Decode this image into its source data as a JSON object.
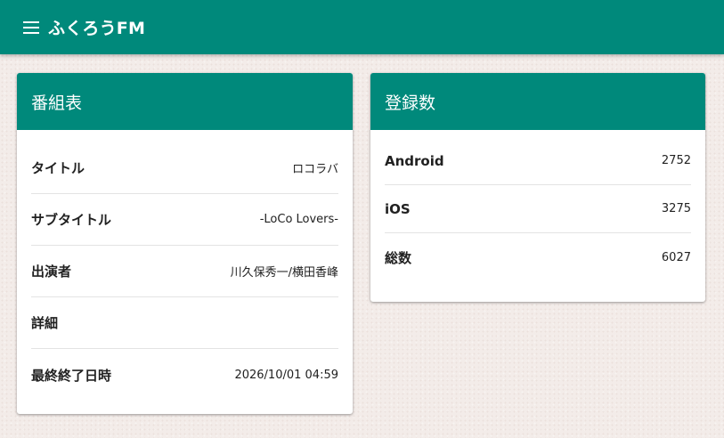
{
  "appbar": {
    "title": "ふくろうFM",
    "menu_icon": "hamburger-menu-icon"
  },
  "program_card": {
    "title": "番組表",
    "rows": [
      {
        "label": "タイトル",
        "value": "ロコラバ"
      },
      {
        "label": "サブタイトル",
        "value": "-LoCo Lovers-"
      },
      {
        "label": "出演者",
        "value": "川久保秀一/横田香峰"
      },
      {
        "label": "詳細",
        "value": ""
      },
      {
        "label": "最終終了日時",
        "value": "2026/10/01 04:59"
      }
    ]
  },
  "subscriptions_card": {
    "title": "登録数",
    "rows": [
      {
        "label": "Android",
        "value": "2752"
      },
      {
        "label": "iOS",
        "value": "3275"
      },
      {
        "label": "総数",
        "value": "6027"
      }
    ]
  },
  "colors": {
    "primary": "#00897b",
    "background": "#f3ece9",
    "card": "#ffffff",
    "divider": "#e3e3e3"
  }
}
